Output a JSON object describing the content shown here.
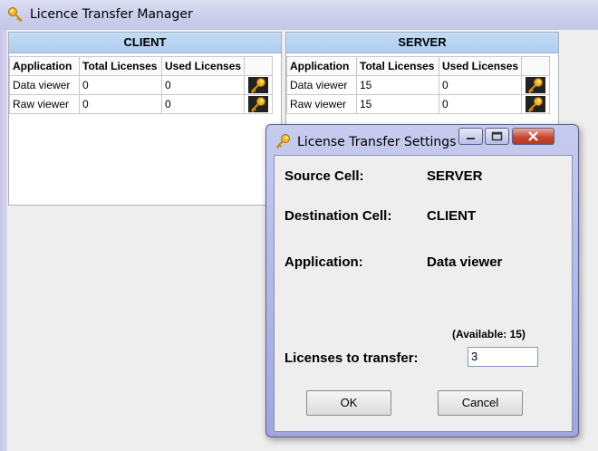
{
  "app": {
    "title": "Licence Transfer Manager"
  },
  "columns": [
    "Application",
    "Total Licenses",
    "Used Licenses"
  ],
  "client": {
    "header": "CLIENT",
    "rows": [
      {
        "app": "Data viewer",
        "total": "0",
        "used": "0"
      },
      {
        "app": "Raw viewer",
        "total": "0",
        "used": "0"
      }
    ]
  },
  "server": {
    "header": "SERVER",
    "rows": [
      {
        "app": "Data viewer",
        "total": "15",
        "used": "0"
      },
      {
        "app": "Raw viewer",
        "total": "15",
        "used": "0"
      }
    ]
  },
  "dialog": {
    "title": "License Transfer Settings",
    "source_label": "Source Cell:",
    "source_value": "SERVER",
    "dest_label": "Destination Cell:",
    "dest_value": "CLIENT",
    "app_label": "Application:",
    "app_value": "Data viewer",
    "available": "(Available: 15)",
    "transfer_label": "Licenses to transfer:",
    "transfer_value": "3",
    "ok": "OK",
    "cancel": "Cancel"
  },
  "icons": {
    "app": "key-icon",
    "row_action": "key-icon"
  }
}
